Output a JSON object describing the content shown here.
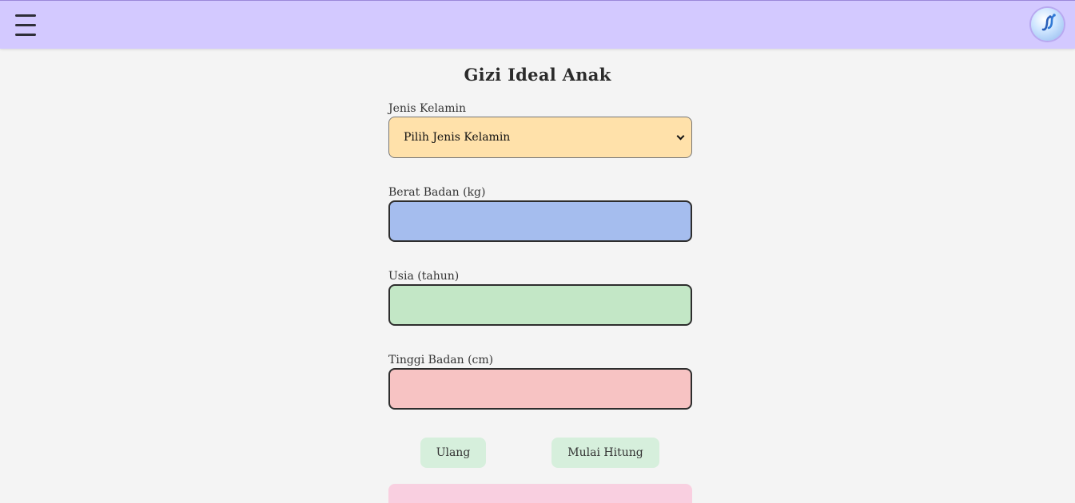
{
  "header": {
    "menu_icon": "hamburger-menu-icon",
    "avatar_icon": "app-logo-avatar",
    "bg_color": "#d3c9ff"
  },
  "page": {
    "title": "Gizi Ideal Anak"
  },
  "form": {
    "gender": {
      "label": "Jenis Kelamin",
      "selected": "Pilih Jenis Kelamin",
      "color": "#ffe1aa"
    },
    "weight": {
      "label": "Berat Badan (kg)",
      "value": "",
      "color": "#a5bdee"
    },
    "age": {
      "label": "Usia (tahun)",
      "value": "",
      "color": "#c3e7c6"
    },
    "height": {
      "label": "Tinggi Badan (cm)",
      "value": "",
      "color": "#f7c3c3"
    }
  },
  "actions": {
    "reset_label": "Ulang",
    "calculate_label": "Mulai Hitung",
    "button_color": "#d6efdc"
  },
  "result": {
    "color": "#f9cfe0"
  }
}
